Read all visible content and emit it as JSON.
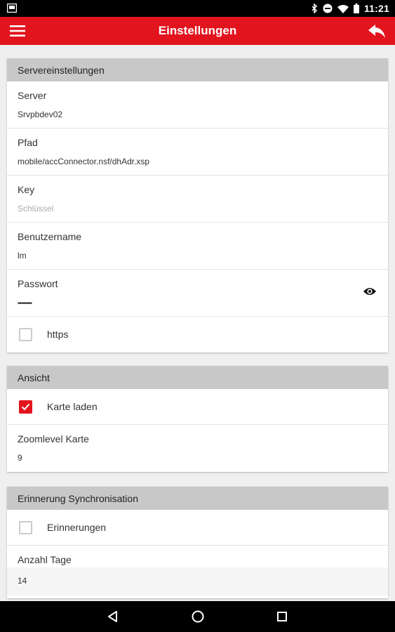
{
  "status_bar": {
    "time": "11:21",
    "icons": [
      "notification-icon",
      "bluetooth-icon",
      "do-not-disturb-icon",
      "wifi-icon",
      "battery-icon"
    ]
  },
  "app_bar": {
    "title": "Einstellungen",
    "menu_icon": "hamburger-menu-icon",
    "back_icon": "reply-back-icon",
    "color": "#e2141e"
  },
  "sections": {
    "server": {
      "header": "Servereinstellungen",
      "server": {
        "label": "Server",
        "value": "Srvpbdev02"
      },
      "path": {
        "label": "Pfad",
        "value": "mobile/accConnector.nsf/dhAdr.xsp"
      },
      "key": {
        "label": "Key",
        "placeholder": "Schlüssel"
      },
      "username": {
        "label": "Benutzername",
        "value": "lm"
      },
      "password": {
        "label": "Passwort",
        "value": "••••••••"
      },
      "https": {
        "label": "https",
        "checked": false
      }
    },
    "view": {
      "header": "Ansicht",
      "load_map": {
        "label": "Karte laden",
        "checked": true
      },
      "zoom": {
        "label": "Zoomlevel Karte",
        "value": "9"
      }
    },
    "sync": {
      "header": "Erinnerung Synchronisation",
      "reminders": {
        "label": "Erinnerungen",
        "checked": false
      },
      "days": {
        "label": "Anzahl Tage",
        "value": "14"
      }
    }
  },
  "nav_bar": {
    "icons": [
      "back-triangle-icon",
      "home-circle-icon",
      "recents-square-icon"
    ]
  }
}
